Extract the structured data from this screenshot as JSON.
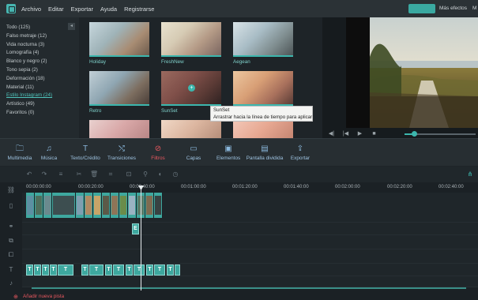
{
  "menu": {
    "items": [
      "Archivo",
      "Editar",
      "Exportar",
      "Ayuda",
      "Registrarse"
    ],
    "more_effects": "Más efectos",
    "more_truncated": "M"
  },
  "categories": [
    "Todo (125)",
    "Falso metraje (12)",
    "Vida nocturna (3)",
    "Lomografía (4)",
    "Blanco y negro (2)",
    "Tono sepia (2)",
    "Deformación (18)",
    "Material (11)",
    "Estilo Instagram (24)",
    "Artístico (49)",
    "Favoritos (0)"
  ],
  "active_category_index": 8,
  "filters": [
    {
      "label": "Holiday"
    },
    {
      "label": "FreshNew"
    },
    {
      "label": "Aegean"
    },
    {
      "label": "Retro"
    },
    {
      "label": "SunSet"
    },
    {
      "label": ""
    },
    {
      "label": ""
    },
    {
      "label": ""
    },
    {
      "label": ""
    }
  ],
  "tooltip": {
    "title": "SunSet",
    "hint": "Arrastrar hacia la línea de tiempo para aplicar"
  },
  "toolbar": [
    {
      "label": "Multimedia",
      "icon": "folder-icon"
    },
    {
      "label": "Música",
      "icon": "music-icon"
    },
    {
      "label": "Texto/Crédito",
      "icon": "text-icon"
    },
    {
      "label": "Transiciones",
      "icon": "transition-icon"
    },
    {
      "label": "Filtros",
      "icon": "filter-icon",
      "active": true
    },
    {
      "label": "Capas",
      "icon": "overlay-icon"
    },
    {
      "label": "Elementos",
      "icon": "image-icon"
    },
    {
      "label": "Pantalla dividida",
      "icon": "split-screen-icon"
    },
    {
      "label": "Exportar",
      "icon": "export-icon"
    }
  ],
  "timeline": {
    "ticks": [
      "00:00:00:00",
      "00:00:20:00",
      "00:00:40:00",
      "00:01:00:00",
      "00:01:20:00",
      "00:01:40:00",
      "00:02:00:00",
      "00:02:20:00",
      "00:02:40:00"
    ],
    "add_track": "Añadir nueva pista"
  },
  "preview": {
    "progress": 0.12
  },
  "colors": {
    "accent": "#3cb6ad",
    "active": "#e8585f"
  }
}
